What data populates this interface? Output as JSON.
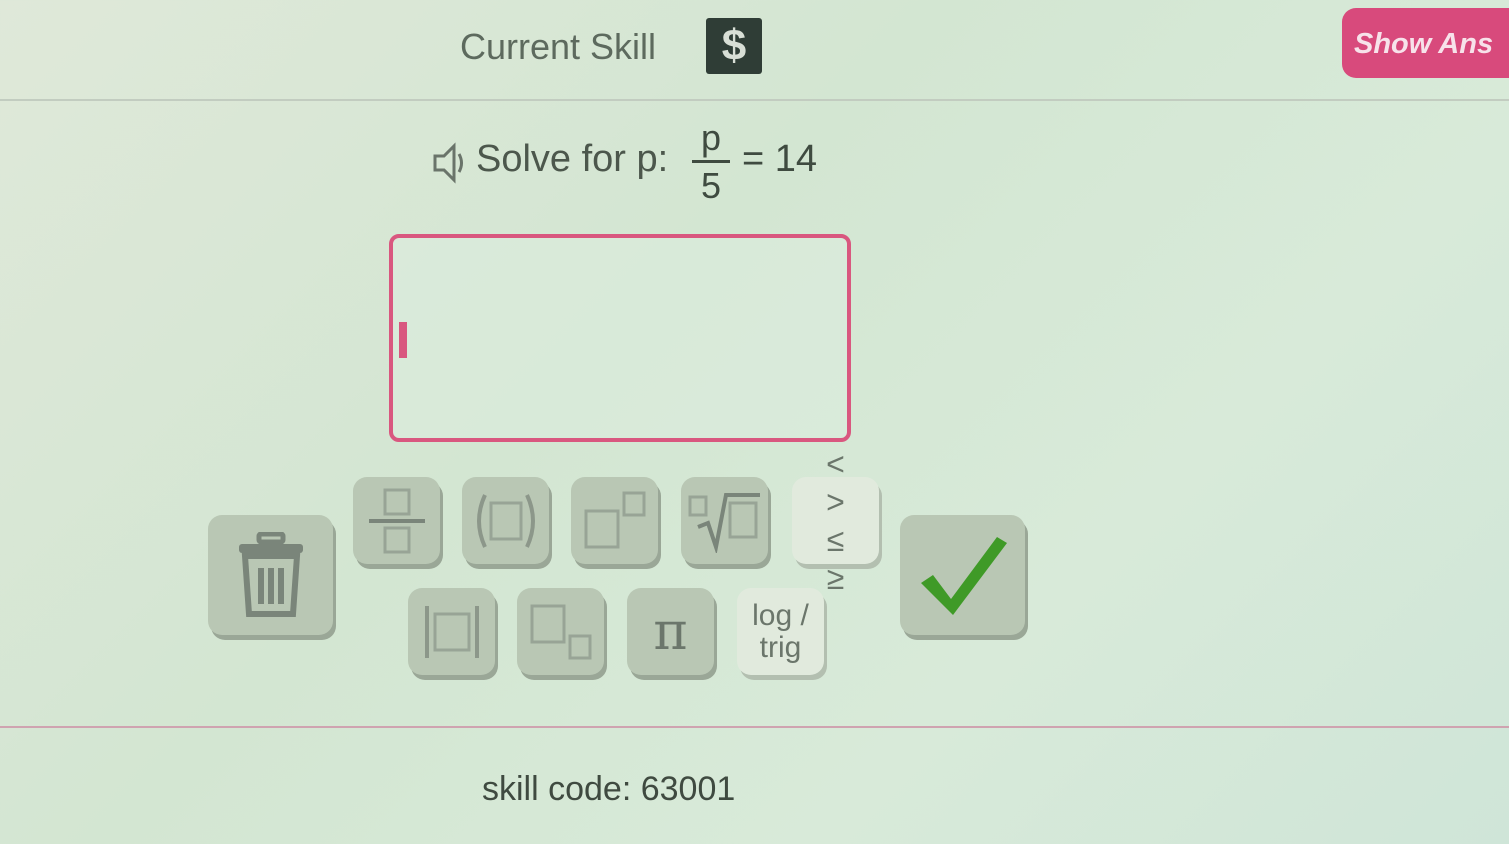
{
  "header": {
    "title": "Current Skill",
    "skill_icon_glyph": "$",
    "skill_icon_name": "dollar-icon",
    "show_answer_label": "Show Ans"
  },
  "question": {
    "prompt": "Solve for p:",
    "numerator": "p",
    "denominator": "5",
    "rhs": "= 14",
    "speaker_icon": "speaker-icon"
  },
  "answer": {
    "value": "",
    "placeholder": ""
  },
  "keypad": {
    "row1": [
      {
        "name": "fraction-icon"
      },
      {
        "name": "parentheses-icon"
      },
      {
        "name": "exponent-icon"
      },
      {
        "name": "root-icon"
      },
      {
        "name": "comparison-key",
        "label": "< >\n≤ ≥"
      }
    ],
    "row2": [
      {
        "name": "absolute-value-icon"
      },
      {
        "name": "subscript-icon"
      },
      {
        "name": "pi-key",
        "label": "π"
      },
      {
        "name": "log-trig-key",
        "label": "log /\ntrig"
      }
    ],
    "delete_icon": "trash-icon",
    "submit_icon": "checkmark-icon"
  },
  "footer": {
    "skill_code_label": "skill code:",
    "skill_code": "63001"
  },
  "colors": {
    "accent_pink": "#d84a7c",
    "check_green": "#3f9a27",
    "key_gray": "#b9c7b4",
    "skill_icon_bg": "#2f3d36"
  }
}
